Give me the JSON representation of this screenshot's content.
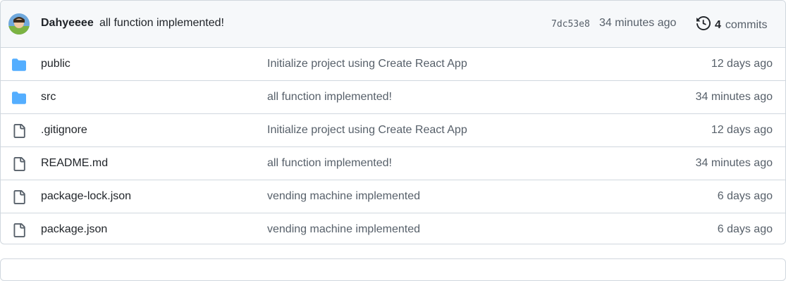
{
  "commit": {
    "author": "Dahyeeee",
    "message": "all function implemented!",
    "sha": "7dc53e8",
    "time": "34 minutes ago",
    "commits_count": "4",
    "commits_label": "commits"
  },
  "files": [
    {
      "type": "folder",
      "name": "public",
      "message": "Initialize project using Create React App",
      "age": "12 days ago"
    },
    {
      "type": "folder",
      "name": "src",
      "message": "all function implemented!",
      "age": "34 minutes ago"
    },
    {
      "type": "file",
      "name": ".gitignore",
      "message": "Initialize project using Create React App",
      "age": "12 days ago"
    },
    {
      "type": "file",
      "name": "README.md",
      "message": "all function implemented!",
      "age": "34 minutes ago"
    },
    {
      "type": "file",
      "name": "package-lock.json",
      "message": "vending machine implemented",
      "age": "6 days ago"
    },
    {
      "type": "file",
      "name": "package.json",
      "message": "vending machine implemented",
      "age": "6 days ago"
    }
  ],
  "colors": {
    "folder_icon": "#54aeff",
    "file_icon": "#57606a",
    "muted_text": "#57606a",
    "border": "#d0d7de",
    "header_bg": "#f6f8fa"
  },
  "icons": {
    "folder": "folder-icon",
    "file": "file-icon",
    "history": "history-icon"
  }
}
